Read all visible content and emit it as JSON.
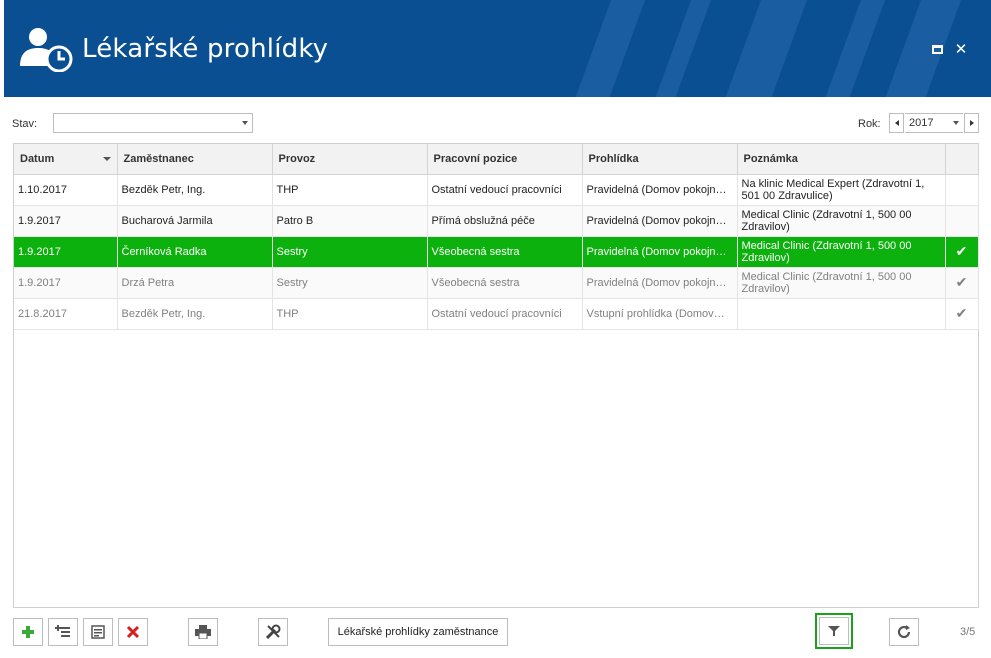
{
  "header": {
    "title": "Lékařské prohlídky",
    "icon": "user-clock-icon",
    "bg_color": "#0b4f93"
  },
  "filters": {
    "stav_label": "Stav:",
    "stav_value": "",
    "rok_label": "Rok:",
    "rok_value": "2017"
  },
  "grid": {
    "columns": [
      "Datum",
      "Zaměstnanec",
      "Provoz",
      "Pracovní pozice",
      "Prohlídka",
      "Poznámka",
      ""
    ],
    "rows": [
      {
        "datum": "1.10.2017",
        "zamestnanec": "Bezděk Petr, Ing.",
        "provoz": "THP",
        "pozice": "Ostatní vedoucí pracovníci",
        "prohlidka": "Pravidelná (Domov pokojné…",
        "poznamka": "Na klinic Medical Expert (Zdravotní 1, 501 00 Zdravulice)",
        "done": ""
      },
      {
        "datum": "1.9.2017",
        "zamestnanec": "Bucharová Jarmila",
        "provoz": "Patro B",
        "pozice": "Přímá obslužná péče",
        "prohlidka": "Pravidelná (Domov pokojné…",
        "poznamka": "Medical Clinic (Zdravotní 1, 500 00 Zdravilov)",
        "done": ""
      },
      {
        "datum": "1.9.2017",
        "zamestnanec": "Černíková Radka",
        "provoz": "Sestry",
        "pozice": "Všeobecná sestra",
        "prohlidka": "Pravidelná (Domov pokojné…",
        "poznamka": "Medical Clinic (Zdravotní 1, 500 00 Zdravilov)",
        "done": "✔"
      },
      {
        "datum": "1.9.2017",
        "zamestnanec": "Drzá Petra",
        "provoz": "Sestry",
        "pozice": "Všeobecná sestra",
        "prohlidka": "Pravidelná (Domov pokojné…",
        "poznamka": "Medical Clinic (Zdravotní 1, 500 00 Zdravilov)",
        "done": "✔"
      },
      {
        "datum": "21.8.2017",
        "zamestnanec": "Bezděk Petr, Ing.",
        "provoz": "THP",
        "pozice": "Ostatní vedoucí pracovníci",
        "prohlidka": "Vstupní prohlídka (Domov…",
        "poznamka": "",
        "done": "✔"
      }
    ],
    "selected_row_color": "#0db10d"
  },
  "toolbar": {
    "add_icon": "plus-icon",
    "add_sub_icon": "add-child-icon",
    "edit_icon": "edit-note-icon",
    "delete_icon": "delete-x-icon",
    "print_icon": "printer-icon",
    "tools_icon": "tools-icon",
    "employee_exams_label": "Lékařské prohlídky zaměstnance",
    "filter_icon": "filter-icon",
    "refresh_icon": "refresh-icon",
    "pager": "3/5"
  }
}
